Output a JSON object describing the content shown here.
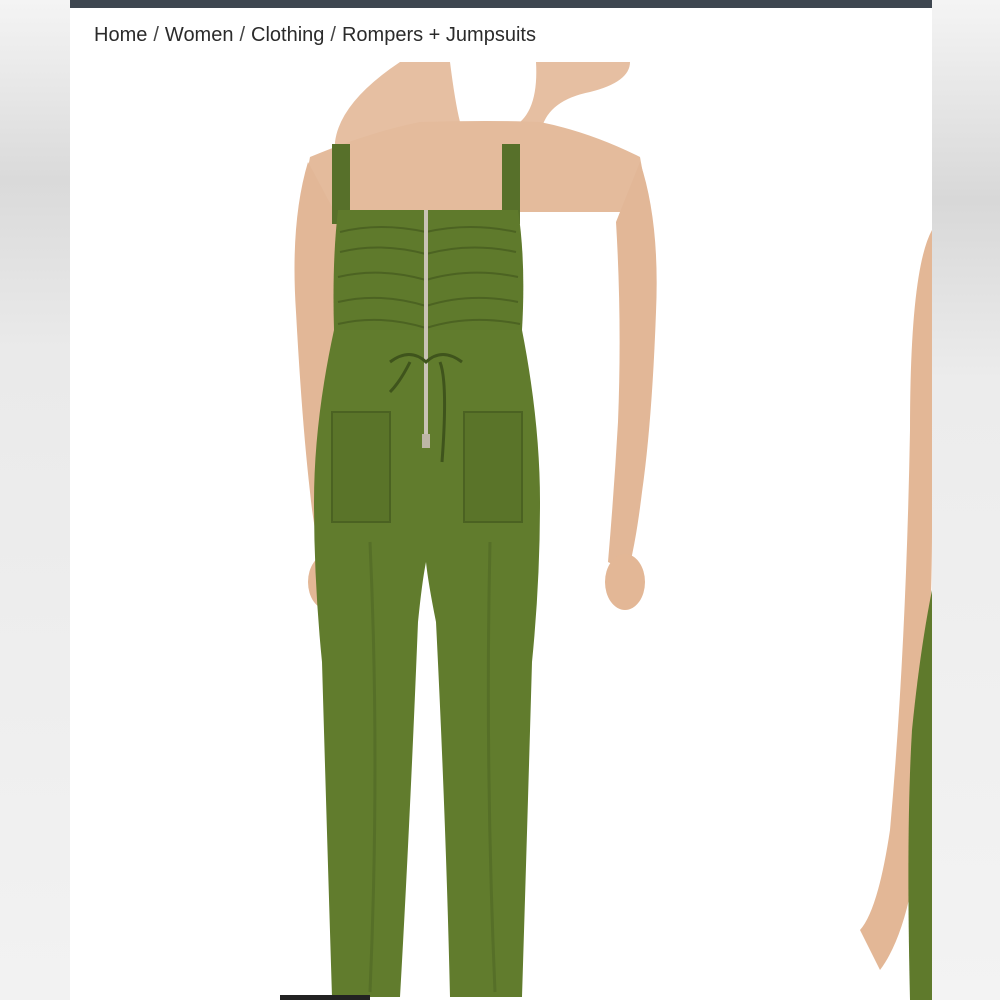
{
  "breadcrumb": {
    "items": [
      "Home",
      "Women",
      "Clothing",
      "Rompers + Jumpsuits"
    ],
    "separator": "/"
  },
  "product": {
    "image_icon": "product-photo-green-jumpsuit",
    "color": "#5f7a2c"
  },
  "colors": {
    "top_bar": "#3e4650",
    "garment": "#5f7a2c"
  }
}
